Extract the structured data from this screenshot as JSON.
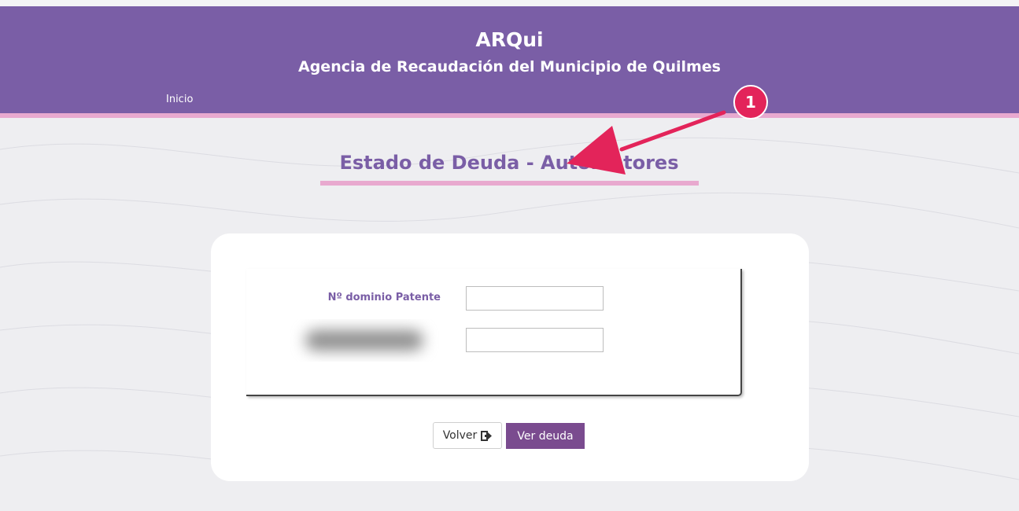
{
  "header": {
    "title": "ARQui",
    "subtitle": "Agencia de Recaudación del Municipio de Quilmes",
    "nav_inicio": "Inicio"
  },
  "page": {
    "title": "Estado de Deuda - Automotores"
  },
  "form": {
    "patente_label": "Nº dominio Patente",
    "patente_value": "",
    "second_value": ""
  },
  "buttons": {
    "volver": "Volver",
    "ver_deuda": "Ver deuda"
  },
  "annotation": {
    "badge": "1"
  },
  "colors": {
    "header_purple": "#7a5ea6",
    "accent_pink": "#e8a9cf",
    "button_purple": "#7a4b8f",
    "annotation_red": "#e3245a"
  }
}
